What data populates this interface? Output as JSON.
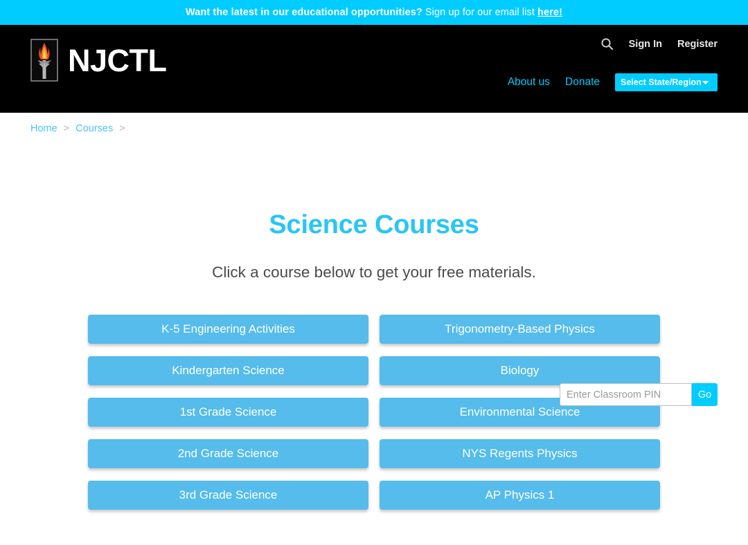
{
  "promo": {
    "strong_text": "Want the latest in our educational opportunities?",
    "rest_text": "Sign up for our email list",
    "link_text": "here!",
    "background_color": "#00ccff"
  },
  "header": {
    "brand_name": "NJCTL",
    "logo_icon": "torch-flame-icon",
    "search_icon": "search-icon",
    "sign_in_label": "Sign In",
    "register_label": "Register",
    "about_label": "About us",
    "donate_label": "Donate",
    "state_select_value": "Select State/Region",
    "state_select_options": [
      "Select State/Region"
    ],
    "background_color": "#000000",
    "accent_color": "#00ccff"
  },
  "breadcrumb": {
    "items": [
      {
        "label": "Home"
      },
      {
        "label": "Courses"
      }
    ],
    "separator": ">"
  },
  "classroom_pin": {
    "placeholder": "Enter Classroom PIN",
    "value": "",
    "go_label": "Go",
    "go_color": "#00ccff"
  },
  "main": {
    "title": "Science Courses",
    "title_color": "#29c5f6",
    "subtitle": "Click a course below to get your free materials.",
    "courses": [
      {
        "label": "K-5 Engineering Activities"
      },
      {
        "label": "Trigonometry-Based Physics"
      },
      {
        "label": "Kindergarten Science"
      },
      {
        "label": "Biology"
      },
      {
        "label": "1st Grade Science"
      },
      {
        "label": "Environmental Science"
      },
      {
        "label": "2nd Grade Science"
      },
      {
        "label": "NYS Regents Physics"
      },
      {
        "label": "3rd Grade Science"
      },
      {
        "label": "AP Physics 1"
      }
    ],
    "course_button_color": "#55bcec"
  }
}
